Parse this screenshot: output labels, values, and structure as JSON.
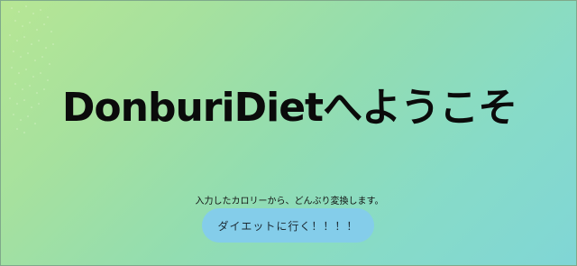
{
  "hero": {
    "title": "DonburiDietへようこそ",
    "subtitle": "入力したカロリーから、どんぶり変換します。",
    "cta_label": "ダイエットに行く！！！！"
  },
  "colors": {
    "background_start": "#b7e694",
    "background_end": "#80d6d6",
    "button": "#84cdea",
    "text": "#0b0b0b"
  }
}
